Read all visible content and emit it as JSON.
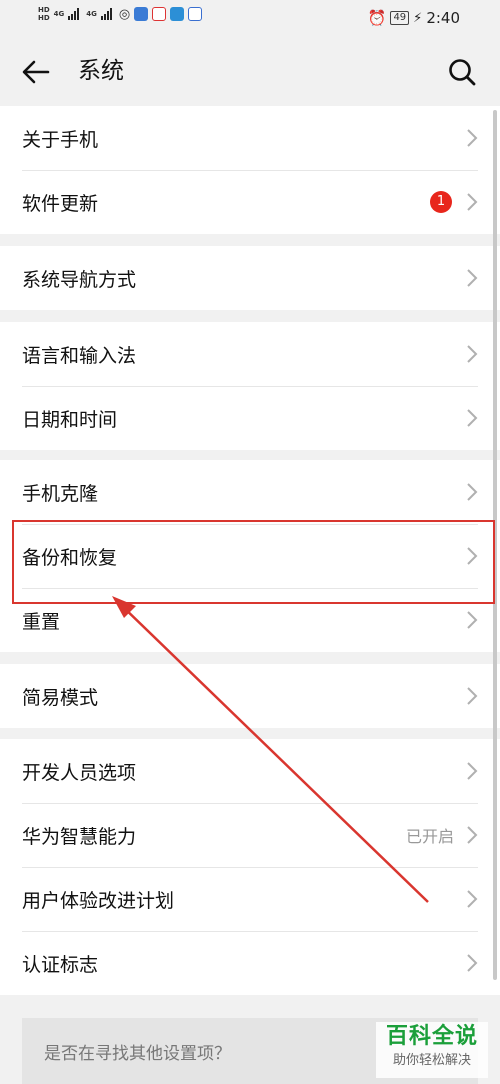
{
  "status_bar": {
    "left_badge_a": "HD",
    "left_badge_b": "HD",
    "signal_a": "4G",
    "signal_b": "4G",
    "battery_level": "49",
    "time": "2:40"
  },
  "header": {
    "title": "系统"
  },
  "groups": [
    {
      "items": [
        {
          "label": "关于手机"
        },
        {
          "label": "软件更新",
          "badge": "1"
        }
      ]
    },
    {
      "items": [
        {
          "label": "系统导航方式"
        }
      ]
    },
    {
      "items": [
        {
          "label": "语言和输入法"
        },
        {
          "label": "日期和时间"
        }
      ]
    },
    {
      "items": [
        {
          "label": "手机克隆"
        },
        {
          "label": "备份和恢复"
        },
        {
          "label": "重置"
        }
      ]
    },
    {
      "items": [
        {
          "label": "简易模式"
        }
      ]
    },
    {
      "items": [
        {
          "label": "开发人员选项"
        },
        {
          "label": "华为智慧能力",
          "value": "已开启"
        },
        {
          "label": "用户体验改进计划"
        },
        {
          "label": "认证标志"
        }
      ]
    }
  ],
  "search_prompt": "是否在寻找其他设置项？",
  "watermark": {
    "title": "百科全说",
    "subtitle": "助你轻松解决"
  },
  "colors": {
    "accent_red": "#d9362f",
    "badge_red": "#e8261c",
    "watermark_green": "#1b9f3a"
  }
}
